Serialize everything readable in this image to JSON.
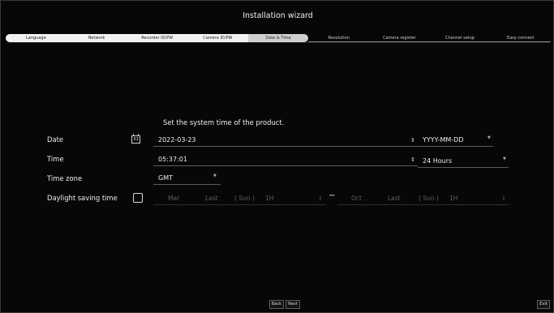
{
  "wizard": {
    "title": "Installation wizard",
    "steps": [
      {
        "label": "Language",
        "state": "done"
      },
      {
        "label": "Network",
        "state": "done"
      },
      {
        "label": "Recorder ID/PW",
        "state": "done"
      },
      {
        "label": "Camera ID/PW",
        "state": "done"
      },
      {
        "label": "Date & Time",
        "state": "current"
      },
      {
        "label": "Resolution",
        "state": "todo"
      },
      {
        "label": "Camera register",
        "state": "todo"
      },
      {
        "label": "Channel setup",
        "state": "todo"
      },
      {
        "label": "Easy connect",
        "state": "todo"
      }
    ]
  },
  "datetime": {
    "subtitle": "Set the system time of the product.",
    "date": {
      "label": "Date",
      "calendar_icon_text": "31",
      "value": "2022-03-23",
      "format": "YYYY-MM-DD"
    },
    "time": {
      "label": "Time",
      "value": "05:37:01",
      "format": "24 Hours"
    },
    "timezone": {
      "label": "Time zone",
      "value": "GMT"
    },
    "dst": {
      "label": "Daylight saving time",
      "checked": false,
      "start": {
        "month": "Mar",
        "week": "Last",
        "day": "( Sun )",
        "hour": "1H"
      },
      "separator": "~",
      "end": {
        "month": "Oct",
        "week": "Last",
        "day": "( Sun )",
        "hour": "1H"
      }
    }
  },
  "footer": {
    "back": "Back",
    "next": "Next",
    "exit": "Exit"
  },
  "icons": {
    "spin": "up-down-spinner-icon",
    "dropdown": "chevron-down-icon",
    "calendar": "calendar-icon"
  }
}
